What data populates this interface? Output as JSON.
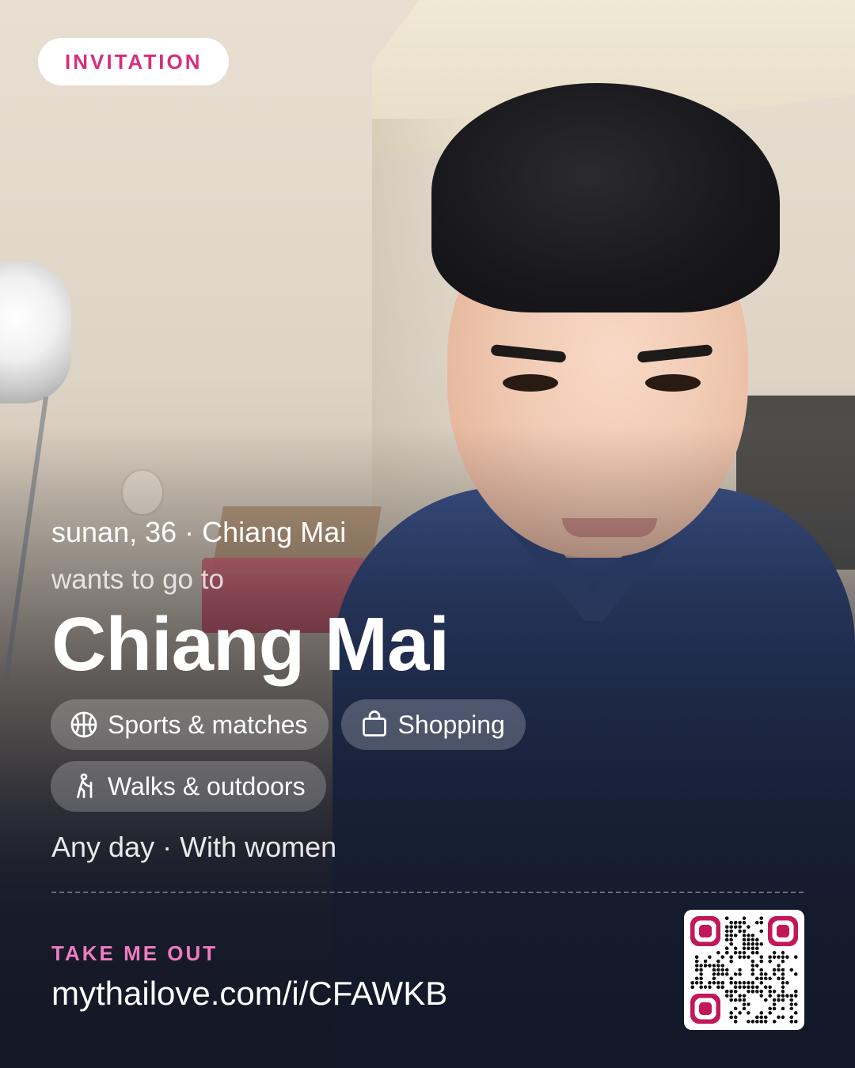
{
  "badge": {
    "label": "INVITATION"
  },
  "profile": {
    "summary": "sunan, 36 · Chiang Mai"
  },
  "intent": {
    "prefix": "wants to go to",
    "destination": "Chiang Mai"
  },
  "tags": [
    {
      "label": "Sports & matches",
      "icon": "basketball-icon"
    },
    {
      "label": "Shopping",
      "icon": "shopping-bag-icon"
    },
    {
      "label": "Walks & outdoors",
      "icon": "hiking-icon"
    }
  ],
  "schedule": {
    "text": "Any day · With women"
  },
  "cta": {
    "label": "TAKE ME OUT",
    "url": "mythailove.com/i/CFAWKB"
  },
  "colors": {
    "accent": "#d62e7e",
    "cta": "#f07cbe",
    "qr_finder": "#c2185b"
  }
}
